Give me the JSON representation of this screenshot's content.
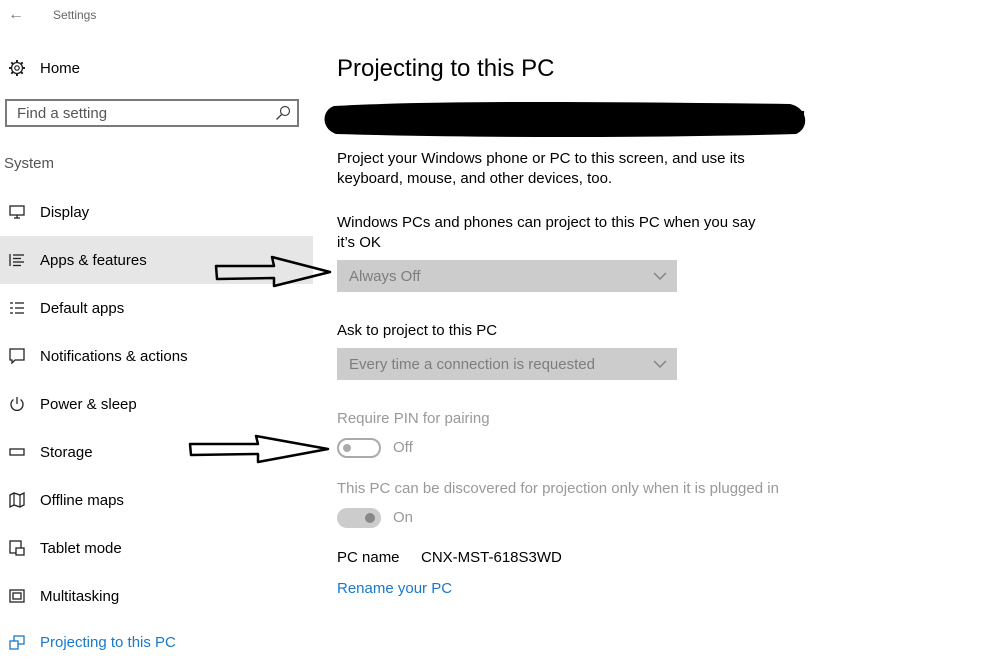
{
  "window": {
    "title": "Settings"
  },
  "sidebar": {
    "home_label": "Home",
    "search_placeholder": "Find a setting",
    "section_label": "System",
    "items": [
      {
        "label": "Display",
        "icon": "monitor-icon"
      },
      {
        "label": "Apps & features",
        "icon": "list-icon"
      },
      {
        "label": "Default apps",
        "icon": "default-apps-icon"
      },
      {
        "label": "Notifications & actions",
        "icon": "notification-icon"
      },
      {
        "label": "Power & sleep",
        "icon": "power-icon"
      },
      {
        "label": "Storage",
        "icon": "storage-icon"
      },
      {
        "label": "Offline maps",
        "icon": "map-icon"
      },
      {
        "label": "Tablet mode",
        "icon": "tablet-icon"
      },
      {
        "label": "Multitasking",
        "icon": "multitasking-icon"
      },
      {
        "label": "Projecting to this PC",
        "icon": "projecting-icon"
      }
    ]
  },
  "main": {
    "title": "Projecting to this PC",
    "description": "Project your Windows phone or PC to this screen, and use its keyboard, mouse, and other devices, too.",
    "project_label": "Windows PCs and phones can project to this PC when you say it’s OK",
    "project_value": "Always Off",
    "ask_label": "Ask to project to this PC",
    "ask_value": "Every time a connection is requested",
    "pin_label": "Require PIN for pairing",
    "pin_state": "Off",
    "plugged_label": "This PC can be discovered for projection only when it is plugged in",
    "plugged_state": "On",
    "pc_name_label": "PC name",
    "pc_name_value": "CNX-MST-618S3WD",
    "rename_link": "Rename your PC"
  },
  "colors": {
    "accent": "#1979ca",
    "disabled_bg": "#cccccc",
    "hover_bg": "#e6e6e6"
  }
}
